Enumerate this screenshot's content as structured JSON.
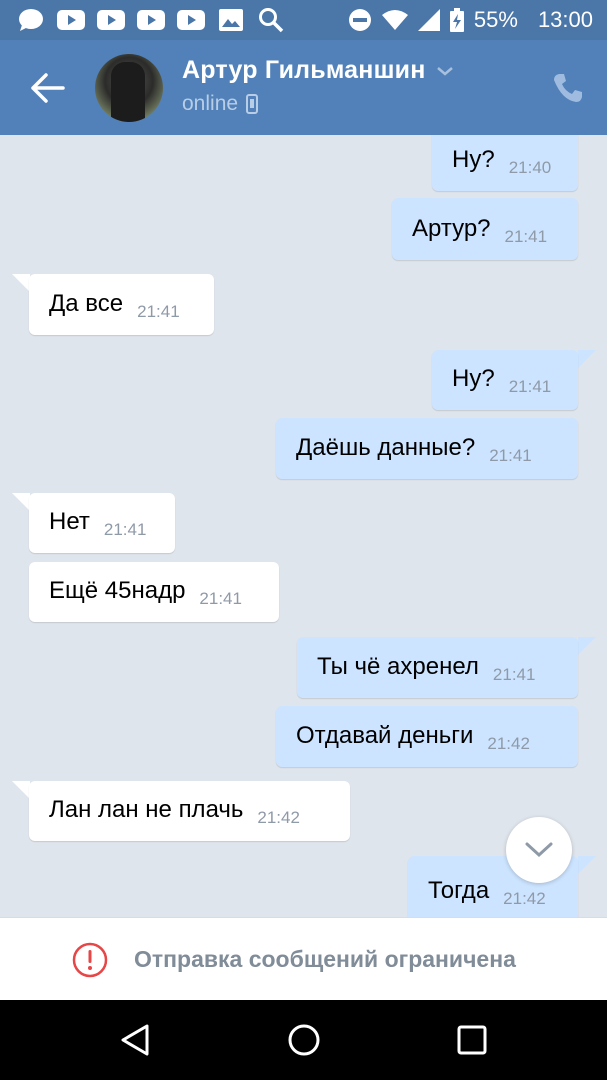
{
  "status_bar": {
    "left_icons": [
      "chat-bubble-icon",
      "youtube-icon",
      "youtube-icon",
      "youtube-icon",
      "youtube-icon",
      "image-icon",
      "search-icon"
    ],
    "battery": "55%",
    "time": "13:00"
  },
  "header": {
    "name": "Артур Гильманшин",
    "status": "online"
  },
  "messages": [
    {
      "dir": "out",
      "text": "Ну?",
      "time": "21:40"
    },
    {
      "dir": "out",
      "text": "Артур?",
      "time": "21:41"
    },
    {
      "dir": "in",
      "text": "Да все",
      "time": "21:41"
    },
    {
      "dir": "out",
      "text": "Ну?",
      "time": "21:41"
    },
    {
      "dir": "out",
      "text": "Даёшь данные?",
      "time": "21:41"
    },
    {
      "dir": "in",
      "text": "Нет",
      "time": "21:41"
    },
    {
      "dir": "in",
      "text": "Ещё 45надр",
      "time": "21:41"
    },
    {
      "dir": "out",
      "text": "Ты чё ахренел",
      "time": "21:41"
    },
    {
      "dir": "out",
      "text": "Отдавай деньги",
      "time": "21:42"
    },
    {
      "dir": "in",
      "text": "Лан лан не плачь",
      "time": "21:42"
    },
    {
      "dir": "out",
      "text": "Тогда",
      "time": "21:42"
    }
  ],
  "restriction": {
    "text": "Отправка сообщений ограничена"
  },
  "colors": {
    "header": "#5181b8",
    "status_bar": "#4a76a8",
    "chat_bg": "#dfe5ec",
    "outgoing_bubble": "#cce4ff",
    "incoming_bubble": "#ffffff",
    "alert_red": "#e64646"
  }
}
